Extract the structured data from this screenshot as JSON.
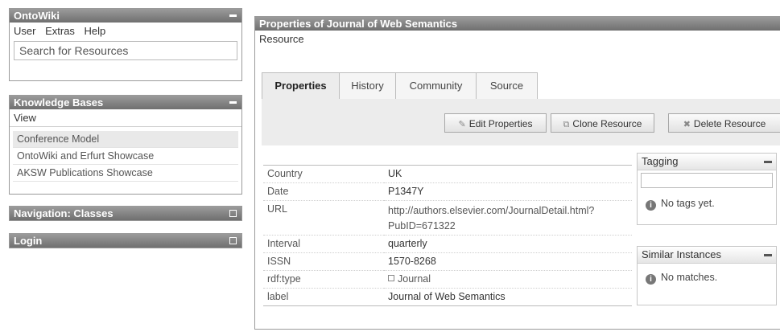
{
  "left": {
    "ontowiki": {
      "title": "OntoWiki",
      "menu": [
        "User",
        "Extras",
        "Help"
      ],
      "search_placeholder": "Search for Resources"
    },
    "kb": {
      "title": "Knowledge Bases",
      "menu": "View",
      "items": [
        "Conference Model",
        "OntoWiki and Erfurt Showcase",
        "AKSW Publications Showcase"
      ],
      "active_index": 0
    },
    "nav": {
      "title": "Navigation: Classes"
    },
    "login": {
      "title": "Login"
    }
  },
  "main": {
    "title": "Properties of Journal of Web Semantics",
    "menu": "Resource",
    "tabs": [
      "Properties",
      "History",
      "Community",
      "Source"
    ],
    "active_tab": 0,
    "toolbar": {
      "edit": "Edit Properties",
      "clone": "Clone Resource",
      "delete": "Delete Resource"
    },
    "properties": [
      {
        "key": "Country",
        "value": "UK"
      },
      {
        "key": "Date",
        "value": "P1347Y"
      },
      {
        "key": "URL",
        "value": "http://authors.elsevier.com/JournalDetail.html?",
        "value2": "PubID=671322"
      },
      {
        "key": "Interval",
        "value": "quarterly"
      },
      {
        "key": "ISSN",
        "value": "1570-8268"
      },
      {
        "key": "rdf:type",
        "value": "Journal"
      },
      {
        "key": "label",
        "value": "Journal of Web Semantics"
      }
    ],
    "tagging": {
      "title": "Tagging",
      "message": "No tags yet."
    },
    "similar": {
      "title": "Similar Instances",
      "message": "No matches."
    }
  },
  "icons": {
    "minimize": "minimize-icon",
    "maximize": "maximize-icon",
    "edit": "pencil-icon",
    "clone": "clone-icon",
    "delete": "x-icon",
    "info": "info-icon",
    "type": "class-icon"
  }
}
